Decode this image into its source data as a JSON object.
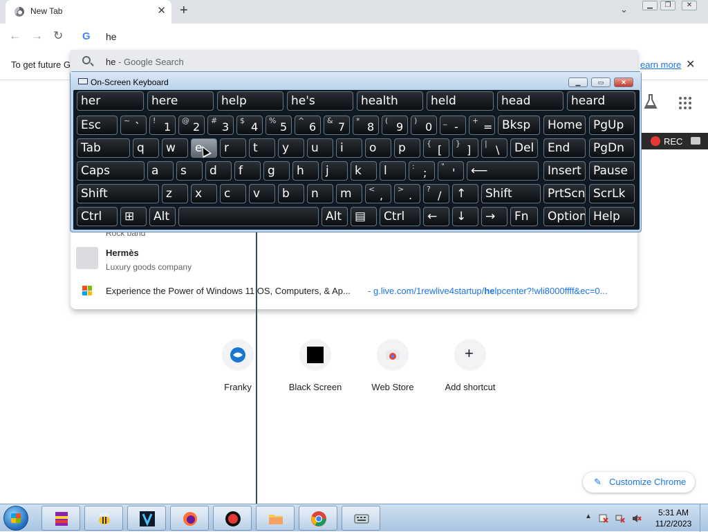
{
  "browser": {
    "tab_title": "New Tab",
    "new_tab_symbol": "+",
    "omnibox_value": "he",
    "infobar_text": "To get future G",
    "infobar_link": "earn more"
  },
  "dropdown": {
    "first_query": "he",
    "first_suffix": " - Google Search",
    "entity_partial": "Rock band",
    "entity_name_bold_prefix": "He",
    "entity_name_rest": "rmès",
    "entity_sub": "Luxury goods company",
    "win_title": "Experience the Power of Windows 11 OS, Computers, & Ap...",
    "win_url_prefix": " - g.live.com/1rewlive4startup/",
    "win_url_bold": "he",
    "win_url_rest": "lpcenter?!wli8000ffff&ec=0..."
  },
  "rec_label": "REC",
  "shortcuts": [
    {
      "label": "Franky"
    },
    {
      "label": "Black Screen"
    },
    {
      "label": "Web Store"
    },
    {
      "label": "Add shortcut",
      "symbol": "+"
    }
  ],
  "customize_label": "Customize Chrome",
  "osk": {
    "title": "On-Screen Keyboard",
    "suggestions": [
      "her",
      "here",
      "help",
      "he's",
      "health",
      "held",
      "head",
      "heard"
    ],
    "row1": [
      "Esc",
      "~`",
      "!1",
      "@2",
      "#3",
      "$4",
      "%5",
      "^6",
      "&7",
      "*8",
      "(9",
      ")0",
      "_-",
      "+=",
      "Bksp",
      "Home",
      "PgUp"
    ],
    "row2": [
      "Tab",
      "q",
      "w",
      "e",
      "r",
      "t",
      "y",
      "u",
      "i",
      "o",
      "p",
      "{[",
      "}]",
      "|\\",
      "Del",
      "End",
      "PgDn"
    ],
    "row3": [
      "Caps",
      "a",
      "s",
      "d",
      "f",
      "g",
      "h",
      "j",
      "k",
      "l",
      ":;",
      "\"'",
      "⟵",
      "Insert",
      "Pause"
    ],
    "row4": [
      "Shift",
      "z",
      "x",
      "c",
      "v",
      "b",
      "n",
      "m",
      "<,",
      ">.",
      "?/",
      "↑",
      "Shift",
      "PrtScn",
      "ScrLk"
    ],
    "row5": [
      "Ctrl",
      "⊞",
      "Alt",
      "",
      "Alt",
      "▤",
      "Ctrl",
      "←",
      "↓",
      "→",
      "Fn",
      "Options",
      "Help"
    ],
    "pressed_key": "e"
  },
  "taskbar": {
    "time": "5:31 AM",
    "date": "11/2/2023"
  }
}
